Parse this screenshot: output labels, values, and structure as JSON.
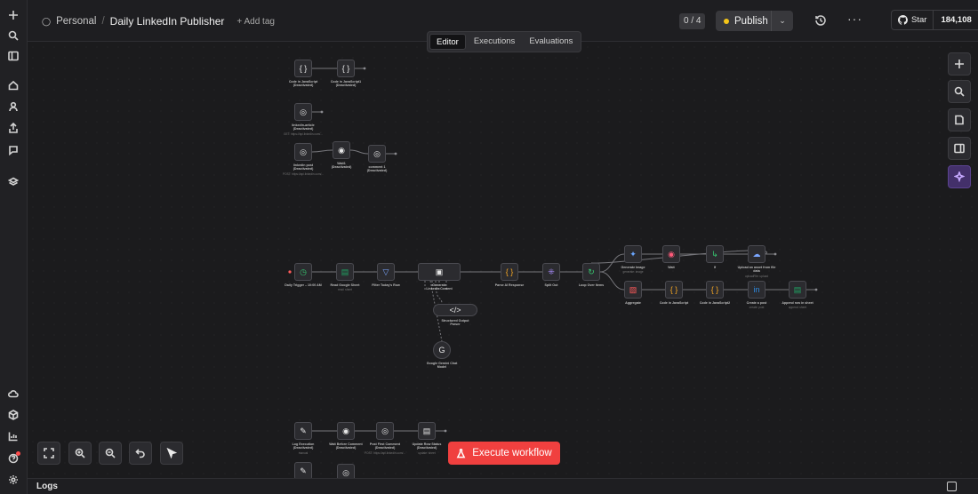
{
  "breadcrumb": {
    "project": "Personal",
    "separator": "/",
    "workflow_name": "Daily LinkedIn Publisher",
    "add_tag": "+ Add tag"
  },
  "header": {
    "counter": "0 / 4",
    "publish_label": "Publish",
    "github_star": "Star",
    "github_count": "184,108"
  },
  "tabs": [
    {
      "label": "Editor",
      "active": true
    },
    {
      "label": "Executions",
      "active": false
    },
    {
      "label": "Evaluations",
      "active": false
    }
  ],
  "execute_label": "Execute workflow",
  "logs_label": "Logs",
  "nodes": [
    {
      "id": "n1",
      "label": "Code in JavaScript\n(Deactivated)",
      "sub": "",
      "icon": "{}",
      "color": "#e6e6e6"
    },
    {
      "id": "n2",
      "label": "Code in JavaScript1\n(Deactivated)",
      "sub": "",
      "icon": "{}",
      "color": "#e6e6e6"
    },
    {
      "id": "n3",
      "label": "linkedin-article\n(Deactivated)",
      "sub": "GET: https://api.linkedin.com/...",
      "icon": "globe",
      "color": "#e6e6e6"
    },
    {
      "id": "n4",
      "label": "linkedin post\n(Deactivated)",
      "sub": "POST: https://api.linkedin.com/...",
      "icon": "globe",
      "color": "#e6e6e6"
    },
    {
      "id": "n5",
      "label": "Wait1\n(Deactivated)",
      "sub": "",
      "icon": "wait",
      "color": "#e6e6e6"
    },
    {
      "id": "n6",
      "label": "comment 1\n(Deactivated)",
      "sub": "",
      "icon": "globe",
      "color": "#e6e6e6"
    },
    {
      "id": "n7",
      "label": "Daily Trigger – 10:00 AM",
      "sub": "",
      "icon": "clock",
      "color": "#37c871"
    },
    {
      "id": "n8",
      "label": "Read Google Sheet",
      "sub": "read: sheet",
      "icon": "sheet",
      "color": "#1fa463"
    },
    {
      "id": "n9",
      "label": "Filter Today's Row",
      "sub": "",
      "icon": "filter",
      "color": "#7aa6ff"
    },
    {
      "id": "n10",
      "label": "Generate\nLinkedIn Content",
      "sub": "",
      "icon": "agent",
      "color": "#e6e6e6"
    },
    {
      "id": "n11",
      "label": "Structured Output\nParser",
      "sub": "",
      "icon": "parser",
      "color": "#e6e6e6"
    },
    {
      "id": "n12",
      "label": "Google Gemini Chat\nModel",
      "sub": "",
      "icon": "gemini",
      "color": "#e6e6e6"
    },
    {
      "id": "n13",
      "label": "Parse AI Response",
      "sub": "",
      "icon": "{}",
      "color": "#f5a623"
    },
    {
      "id": "n14",
      "label": "Split Out",
      "sub": "",
      "icon": "split",
      "color": "#a78bfa"
    },
    {
      "id": "n15",
      "label": "Loop Over Items",
      "sub": "",
      "icon": "loop",
      "color": "#37c871"
    },
    {
      "id": "n16",
      "label": "Generate Image",
      "sub": "generate: image",
      "icon": "spark",
      "color": "#6aa7ff"
    },
    {
      "id": "n17",
      "label": "Wait",
      "sub": "",
      "icon": "wait",
      "color": "#ff5a7a"
    },
    {
      "id": "n18",
      "label": "If",
      "sub": "",
      "icon": "if",
      "color": "#37c871"
    },
    {
      "id": "n19",
      "label": "Upload an asset from file\ndata",
      "sub": "uploadFile: upload",
      "icon": "upload",
      "color": "#7aa6ff"
    },
    {
      "id": "n20",
      "label": "Aggregate",
      "sub": "",
      "icon": "aggregate",
      "color": "#ff5a5a"
    },
    {
      "id": "n21",
      "label": "Code in JavaScript",
      "sub": "",
      "icon": "{}",
      "color": "#f5a623"
    },
    {
      "id": "n22",
      "label": "Code in JavaScript2",
      "sub": "",
      "icon": "{}",
      "color": "#f5a623"
    },
    {
      "id": "n23",
      "label": "Create a post",
      "sub": "create: post",
      "icon": "in",
      "color": "#2d8ae0"
    },
    {
      "id": "n24",
      "label": "Append row in sheet",
      "sub": "append: sheet",
      "icon": "sheet",
      "color": "#1fa463"
    },
    {
      "id": "n25",
      "label": "Log Execution\n(Deactivated)",
      "sub": "manual",
      "icon": "pencil",
      "color": "#e6e6e6"
    },
    {
      "id": "n26",
      "label": "Wait Before Comment\n(Deactivated)",
      "sub": "",
      "icon": "wait",
      "color": "#e6e6e6"
    },
    {
      "id": "n27",
      "label": "Post First Comment\n(Deactivated)",
      "sub": "POST: https://api.linkedin.com/...",
      "icon": "globe",
      "color": "#e6e6e6"
    },
    {
      "id": "n28",
      "label": "Update Row Status\n(Deactivated)",
      "sub": "update: sheet",
      "icon": "doc",
      "color": "#e6e6e6"
    },
    {
      "id": "n29",
      "label": "",
      "sub": "",
      "icon": "pencil",
      "color": "#e6e6e6"
    },
    {
      "id": "n30",
      "label": "",
      "sub": "",
      "icon": "globe",
      "color": "#e6e6e6"
    }
  ],
  "connections": [
    [
      "n1",
      "n2"
    ],
    [
      "n4",
      "n5"
    ],
    [
      "n5",
      "n6"
    ],
    [
      "n7",
      "n8"
    ],
    [
      "n8",
      "n9"
    ],
    [
      "n9",
      "n10"
    ],
    [
      "n10",
      "n13"
    ],
    [
      "n13",
      "n14"
    ],
    [
      "n14",
      "n15"
    ],
    [
      "n15",
      "n16"
    ],
    [
      "n16",
      "n17"
    ],
    [
      "n17",
      "n18"
    ],
    [
      "n18",
      "n19"
    ],
    [
      "n18",
      "n19b"
    ],
    [
      "n15",
      "n20"
    ],
    [
      "n20",
      "n21"
    ],
    [
      "n21",
      "n22"
    ],
    [
      "n22",
      "n23"
    ],
    [
      "n23",
      "n24"
    ],
    [
      "n25",
      "n26"
    ],
    [
      "n26",
      "n27"
    ],
    [
      "n27",
      "n28"
    ]
  ]
}
